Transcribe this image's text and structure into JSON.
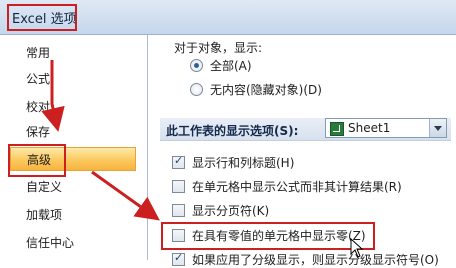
{
  "window": {
    "title": "Excel 选项"
  },
  "sidebar": {
    "items": [
      {
        "label": "常用"
      },
      {
        "label": "公式"
      },
      {
        "label": "校对"
      },
      {
        "label": "保存"
      },
      {
        "label": "高级"
      },
      {
        "label": "自定义"
      },
      {
        "label": "加载项"
      },
      {
        "label": "信任中心"
      }
    ],
    "active": "高级"
  },
  "main": {
    "objects_heading": "对于对象，显示:",
    "radio_all": "全部(A)",
    "radio_none": "无内容(隐藏对象)(D)",
    "sheet_section_label": "此工作表的显示选项(S):",
    "sheet_select_value": "Sheet1",
    "options": [
      {
        "label": "显示行和列标题(H)",
        "checked": true
      },
      {
        "label": "在单元格中显示公式而非其计算结果(R)",
        "checked": false
      },
      {
        "label": "显示分页符(K)",
        "checked": false
      },
      {
        "label": "在具有零值的单元格中显示零(Z)",
        "checked": false
      },
      {
        "label": "如果应用了分级显示，则显示分级显示符号(O)",
        "checked": true
      }
    ]
  },
  "colors": {
    "highlight_red": "#cc2020",
    "active_gold": "#f7b33d"
  }
}
